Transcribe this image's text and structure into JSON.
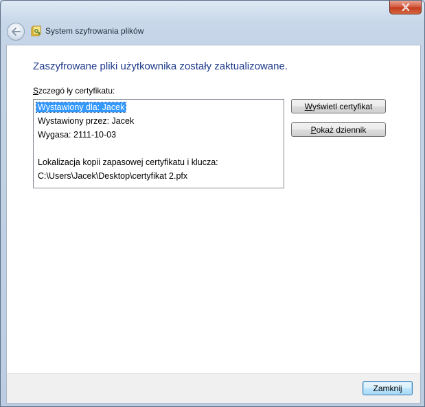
{
  "window": {
    "title": "System szyfrowania plików"
  },
  "main": {
    "heading": "Zaszyfrowane pliki użytkownika zostały zaktualizowane.",
    "details_label_prefix": "S",
    "details_label_rest": "zczegó ły certyfikatu:",
    "details_lines": [
      "Wystawiony dla: Jacek",
      "Wystawiony przez: Jacek",
      "Wygasa: 2111-10-03",
      "Lokalizacja kopii zapasowej certyfikatu i klucza:",
      "C:\\Users\\Jacek\\Desktop\\certyfikat 2.pfx"
    ]
  },
  "buttons": {
    "view_cert_u": "W",
    "view_cert_rest": "yświetl certyfikat",
    "show_log_u": "P",
    "show_log_rest": "okaż dziennik",
    "close": "Zamknij"
  },
  "colors": {
    "heading": "#1e3a8a",
    "selection": "#3399ff",
    "close_button": "#c23a1f"
  }
}
